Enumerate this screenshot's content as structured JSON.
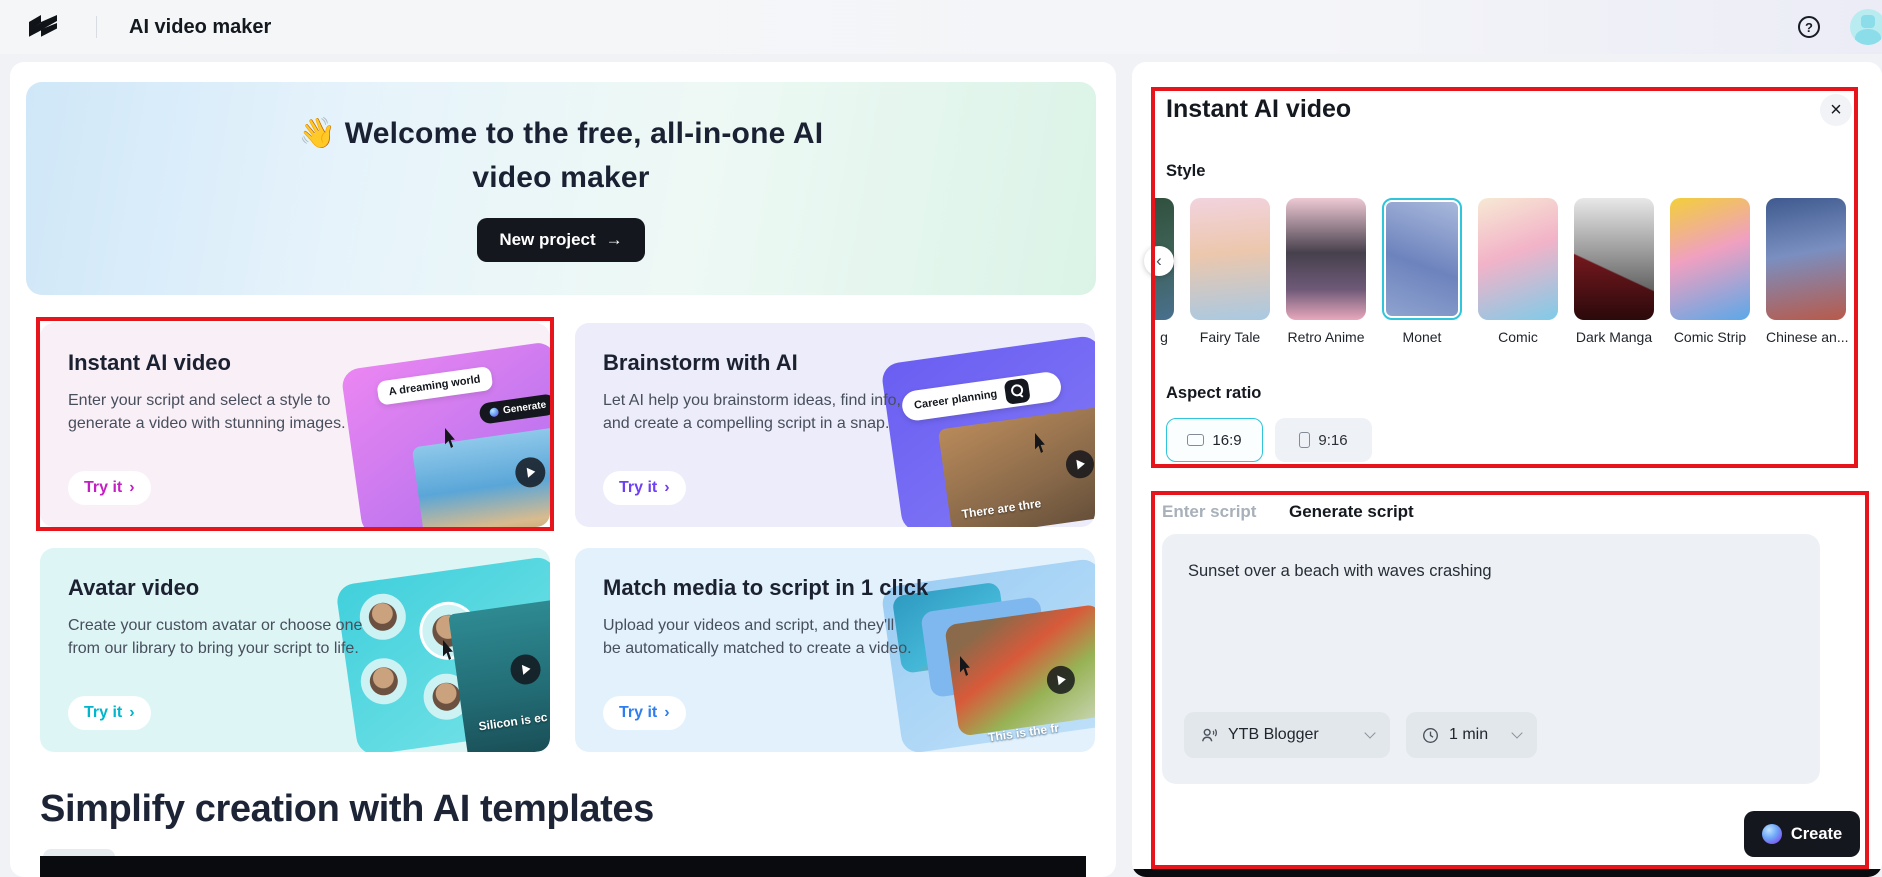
{
  "topbar": {
    "title": "AI video maker",
    "help_glyph": "?"
  },
  "banner": {
    "line1": "👋 Welcome to the free, all-in-one AI",
    "line2": "video maker",
    "new_project": "New project",
    "arrow": "→"
  },
  "cards": [
    {
      "title": "Instant AI video",
      "description": "Enter your script and select a style to generate a video with stunning images.",
      "try_it": "Try it",
      "chevron": "›",
      "overlay_label": "A dreaming world",
      "overlay_button": "Generate"
    },
    {
      "title": "Brainstorm with AI",
      "description": "Let AI help you brainstorm ideas, find info, and create a compelling script in a snap.",
      "try_it": "Try it",
      "chevron": "›",
      "overlay_search": "Career planning",
      "overlay_caption": "There are thre"
    },
    {
      "title": "Avatar video",
      "description": "Create your custom avatar or choose one from our library to bring your script to life.",
      "try_it": "Try it",
      "chevron": "›",
      "overlay_caption": "Silicon is ec"
    },
    {
      "title": "Match media to script in 1 click",
      "description": "Upload your videos and script, and they'll be automatically matched to create a video.",
      "try_it": "Try it",
      "chevron": "›",
      "overlay_caption": "This is the fr"
    }
  ],
  "templates": {
    "heading": "Simplify creation with AI templates"
  },
  "panel": {
    "title": "Instant AI video",
    "close_glyph": "×",
    "style_label": "Style",
    "style_prev_glyph": "‹",
    "styles": [
      {
        "label": "g"
      },
      {
        "label": "Fairy Tale"
      },
      {
        "label": "Retro Anime"
      },
      {
        "label": "Monet",
        "selected": true
      },
      {
        "label": "Comic"
      },
      {
        "label": "Dark Manga"
      },
      {
        "label": "Comic Strip"
      },
      {
        "label": "Chinese an..."
      }
    ],
    "aspect_label": "Aspect ratio",
    "aspect_options": [
      {
        "label": "16:9",
        "selected": true
      },
      {
        "label": "9:16",
        "selected": false
      }
    ],
    "tabs": [
      {
        "label": "Enter script",
        "active": false
      },
      {
        "label": "Generate script",
        "active": true
      }
    ],
    "script_text": "Sunset over a beach with waves crashing",
    "voice": "YTB Blogger",
    "duration": "1 min",
    "create": "Create"
  },
  "colors": {
    "annotation_red": "#e8141c",
    "selected_cyan": "#2fc5da",
    "accent_instant": "#c41fc4",
    "accent_brainstorm": "#6f3ff5",
    "accent_avatar": "#00b5cc",
    "accent_match": "#2e7ef0",
    "create_button_bg": "#14171e"
  }
}
